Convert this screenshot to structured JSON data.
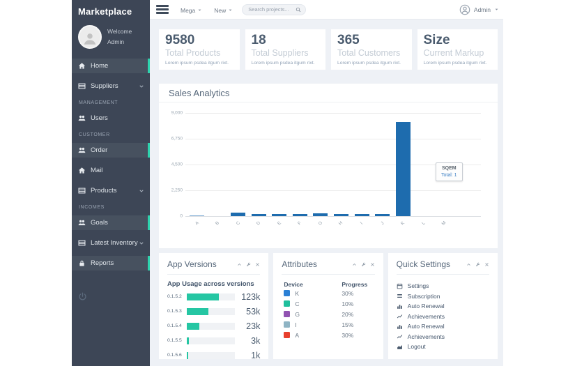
{
  "sidebar": {
    "brand": "Marketplace",
    "user": {
      "welcome": "Welcome",
      "name": "Admin"
    },
    "accent_color": "#2ed3ae",
    "items": [
      {
        "label": "Home",
        "icon": "home-icon",
        "active": true
      },
      {
        "label": "Suppliers",
        "icon": "table-icon",
        "chevron": true
      },
      {
        "section": "MANAGEMENT"
      },
      {
        "label": "Users",
        "icon": "users-icon"
      },
      {
        "section": "CUSTOMER"
      },
      {
        "label": "Order",
        "icon": "users-icon",
        "active": true
      },
      {
        "label": "Mail",
        "icon": "home-icon"
      },
      {
        "label": "Products",
        "icon": "table-icon",
        "chevron": true
      },
      {
        "section": "INCOMES"
      },
      {
        "label": "Goals",
        "icon": "users-icon",
        "active": true
      },
      {
        "label": "Latest Inventory",
        "icon": "table-icon",
        "chevron": true
      },
      {
        "label": "Reports",
        "icon": "lock-icon",
        "active": true
      }
    ]
  },
  "topbar": {
    "menu": [
      {
        "label": "Mega"
      },
      {
        "label": "New"
      }
    ],
    "search_placeholder": "Search projects...",
    "user_label": "Admin"
  },
  "stat_cards": [
    {
      "value": "9580",
      "label": "Total Products",
      "caption": "Lorem ipsum psdea itgum rixt."
    },
    {
      "value": "18",
      "label": "Total Suppliers",
      "caption": "Lorem ipsum psdea itgum rixt."
    },
    {
      "value": "365",
      "label": "Total Customers",
      "caption": "Lorem ipsum psdea itgum rixt."
    },
    {
      "value": "Size",
      "label": "Current Markup",
      "caption": "Lorem ipsum psdea itgum rixt."
    }
  ],
  "sales_panel": {
    "title": "Sales Analytics"
  },
  "chart_data": {
    "type": "bar",
    "title": "Sales Analytics",
    "categories": [
      "A",
      "B",
      "C",
      "D",
      "E",
      "F",
      "G",
      "H",
      "I",
      "J",
      "K",
      "L",
      "M"
    ],
    "values": [
      60,
      0,
      280,
      200,
      180,
      160,
      240,
      180,
      180,
      200,
      8200,
      0,
      0
    ],
    "ylim": [
      0,
      9000
    ],
    "yticks": [
      "9,000",
      "6,750",
      "4,500",
      "2,250",
      "0"
    ],
    "xlabel": "",
    "ylabel": "",
    "grid": true,
    "legend": false,
    "bar_color": "#1e6cae",
    "bar_colors": [
      "#7aa9d4",
      null,
      null,
      null,
      null,
      null,
      null,
      null,
      null,
      null,
      "#1e6cae",
      null,
      null
    ],
    "tooltip": {
      "label": "SQEM",
      "value": "Total: 1"
    }
  },
  "app_versions": {
    "title": "App Versions",
    "subtitle": "App Usage across versions",
    "bar_color": "#25c6a3",
    "rows": [
      {
        "version": "0.1.5.2",
        "value": "123k",
        "percent": 67
      },
      {
        "version": "0.1.5.3",
        "value": "53k",
        "percent": 45
      },
      {
        "version": "0.1.5.4",
        "value": "23k",
        "percent": 26
      },
      {
        "version": "0.1.5.5",
        "value": "3k",
        "percent": 5
      },
      {
        "version": "0.1.5.6",
        "value": "1k",
        "percent": 3
      }
    ]
  },
  "attributes": {
    "title": "Attributes",
    "columns": [
      "Device",
      "Progress"
    ],
    "rows": [
      {
        "device": "K",
        "color": "#2b80d5",
        "progress": "30%"
      },
      {
        "device": "C",
        "color": "#1fbf9c",
        "progress": "10%"
      },
      {
        "device": "G",
        "color": "#9153b1",
        "progress": "20%"
      },
      {
        "device": "I",
        "color": "#8fb4c4",
        "progress": "15%"
      },
      {
        "device": "A",
        "color": "#e8402d",
        "progress": "30%"
      }
    ]
  },
  "quick_settings": {
    "title": "Quick Settings",
    "items": [
      {
        "label": "Settings",
        "icon": "calendar-icon"
      },
      {
        "label": "Subscription",
        "icon": "list-icon"
      },
      {
        "label": "Auto Renewal",
        "icon": "bar-chart-icon"
      },
      {
        "label": "Achievements",
        "icon": "line-chart-icon"
      },
      {
        "label": "Auto Renewal",
        "icon": "bar-chart-icon"
      },
      {
        "label": "Achievements",
        "icon": "line-chart-icon"
      },
      {
        "label": "Logout",
        "icon": "area-chart-icon"
      }
    ]
  },
  "panel_controls": [
    {
      "name": "collapse",
      "icon": "chevron-up-icon"
    },
    {
      "name": "settings",
      "icon": "wrench-icon"
    },
    {
      "name": "close",
      "icon": "close-icon"
    }
  ]
}
